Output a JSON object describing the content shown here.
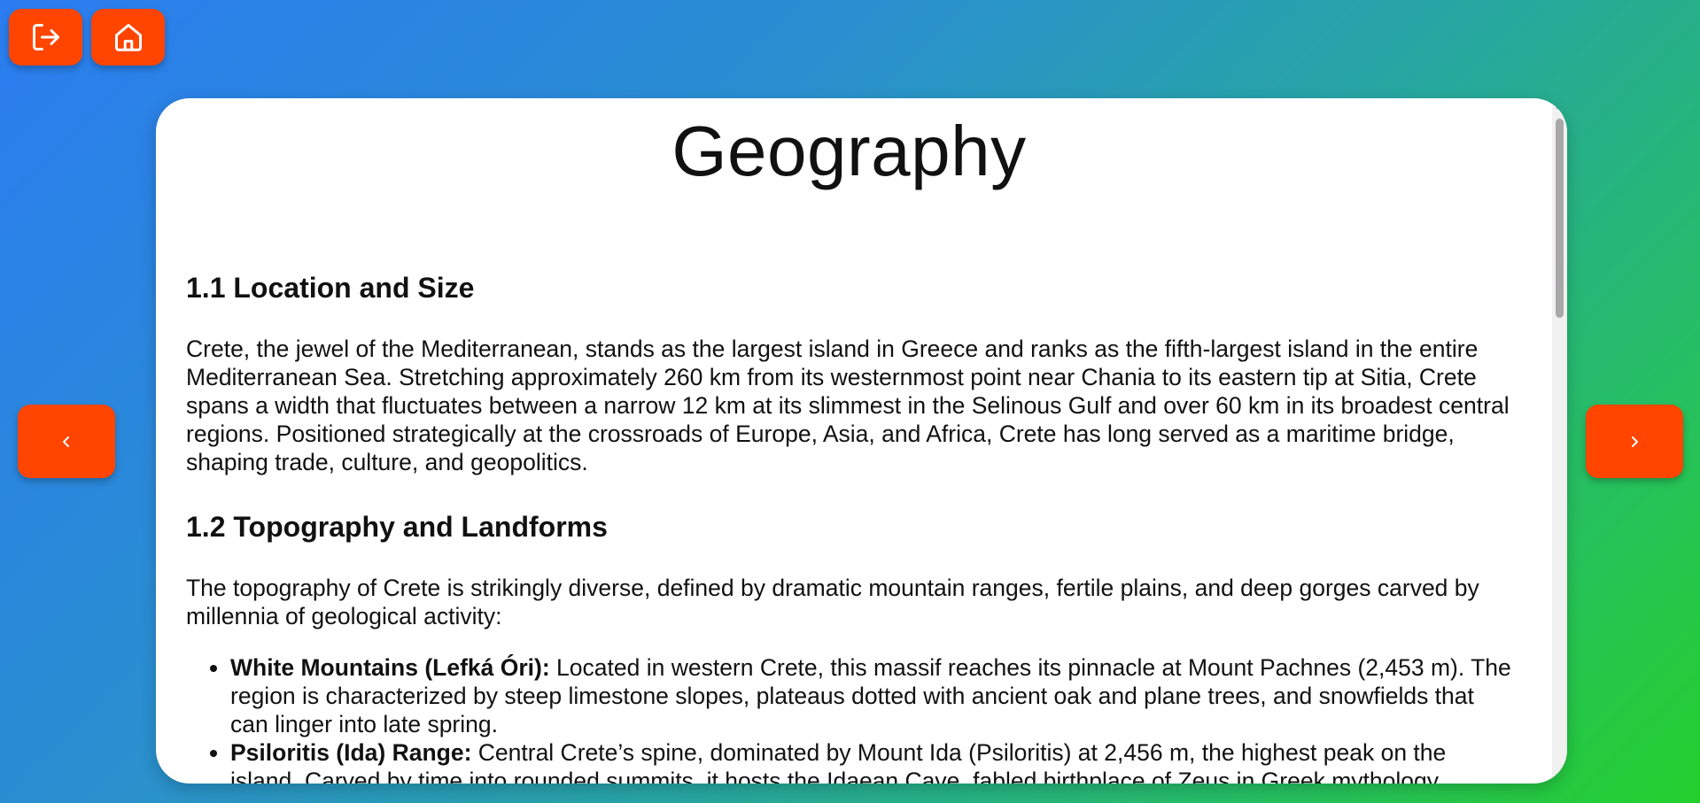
{
  "icons": {
    "logout": "logout-icon",
    "home": "home-icon",
    "prev": "chevron-left-icon",
    "next": "chevron-right-icon"
  },
  "colors": {
    "button": "#ff4500",
    "card": "#ffffff"
  },
  "page": {
    "title": "Geography"
  },
  "sections": [
    {
      "heading": "1.1 Location and Size",
      "paragraph": "Crete, the jewel of the Mediterranean, stands as the largest island in Greece and ranks as the fifth-largest island in the entire Mediterranean Sea. Stretching approximately 260 km from its westernmost point near Chania to its eastern tip at Sitia, Crete spans a width that fluctuates between a narrow 12 km at its slimmest in the Selinous Gulf and over 60 km in its broadest central regions. Positioned strategically at the crossroads of Europe, Asia, and Africa, Crete has long served as a maritime bridge, shaping trade, culture, and geopolitics."
    },
    {
      "heading": "1.2 Topography and Landforms",
      "paragraph": "The topography of Crete is strikingly diverse, defined by dramatic mountain ranges, fertile plains, and deep gorges carved by millennia of geological activity:",
      "items": [
        {
          "term": "White Mountains (Lefká Óri):",
          "text": " Located in western Crete, this massif reaches its pinnacle at Mount Pachnes (2,453 m). The region is characterized by steep limestone slopes, plateaus dotted with ancient oak and plane trees, and snowfields that can linger into late spring."
        },
        {
          "term": "Psiloritis (Ida) Range:",
          "text": " Central Crete’s spine, dominated by Mount Ida (Psiloritis) at 2,456 m, the highest peak on the island. Carved by time into rounded summits, it hosts the Idaean Cave, fabled birthplace of Zeus in Greek mythology."
        }
      ]
    }
  ]
}
